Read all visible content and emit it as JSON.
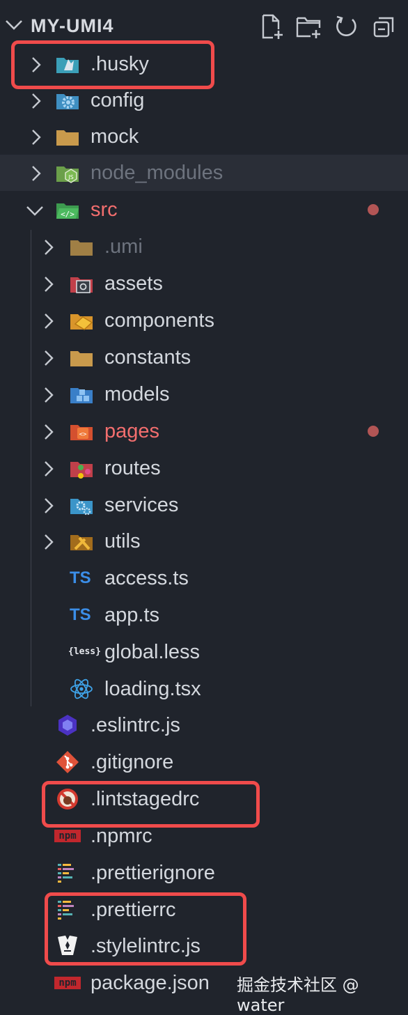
{
  "explorer": {
    "title": "MY-UMI4",
    "actions": [
      "new-file-icon",
      "new-folder-icon",
      "refresh-icon",
      "collapse-all-icon"
    ]
  },
  "tree": {
    "husky": ".husky",
    "config": "config",
    "mock": "mock",
    "node_modules": "node_modules",
    "src": "src",
    "umi": ".umi",
    "assets": "assets",
    "components": "components",
    "constants": "constants",
    "models": "models",
    "pages": "pages",
    "routes": "routes",
    "services": "services",
    "utils": "utils",
    "access": "access.ts",
    "app": "app.ts",
    "global": "global.less",
    "loading": "loading.tsx",
    "eslintrc": ".eslintrc.js",
    "gitignore": ".gitignore",
    "lintstagedrc": ".lintstagedrc",
    "npmrc": ".npmrc",
    "prettierignore": ".prettierignore",
    "prettierrc": ".prettierrc",
    "stylelintrc": ".stylelintrc.js",
    "package": "package.json"
  },
  "icon_text": {
    "ts": "TS",
    "less": "{less}",
    "npm": "npm"
  },
  "colors": {
    "background": "#20242c",
    "modified": "#f26e6e",
    "highlight": "#f04b4b"
  },
  "watermark": "掘金技术社区 @ water"
}
